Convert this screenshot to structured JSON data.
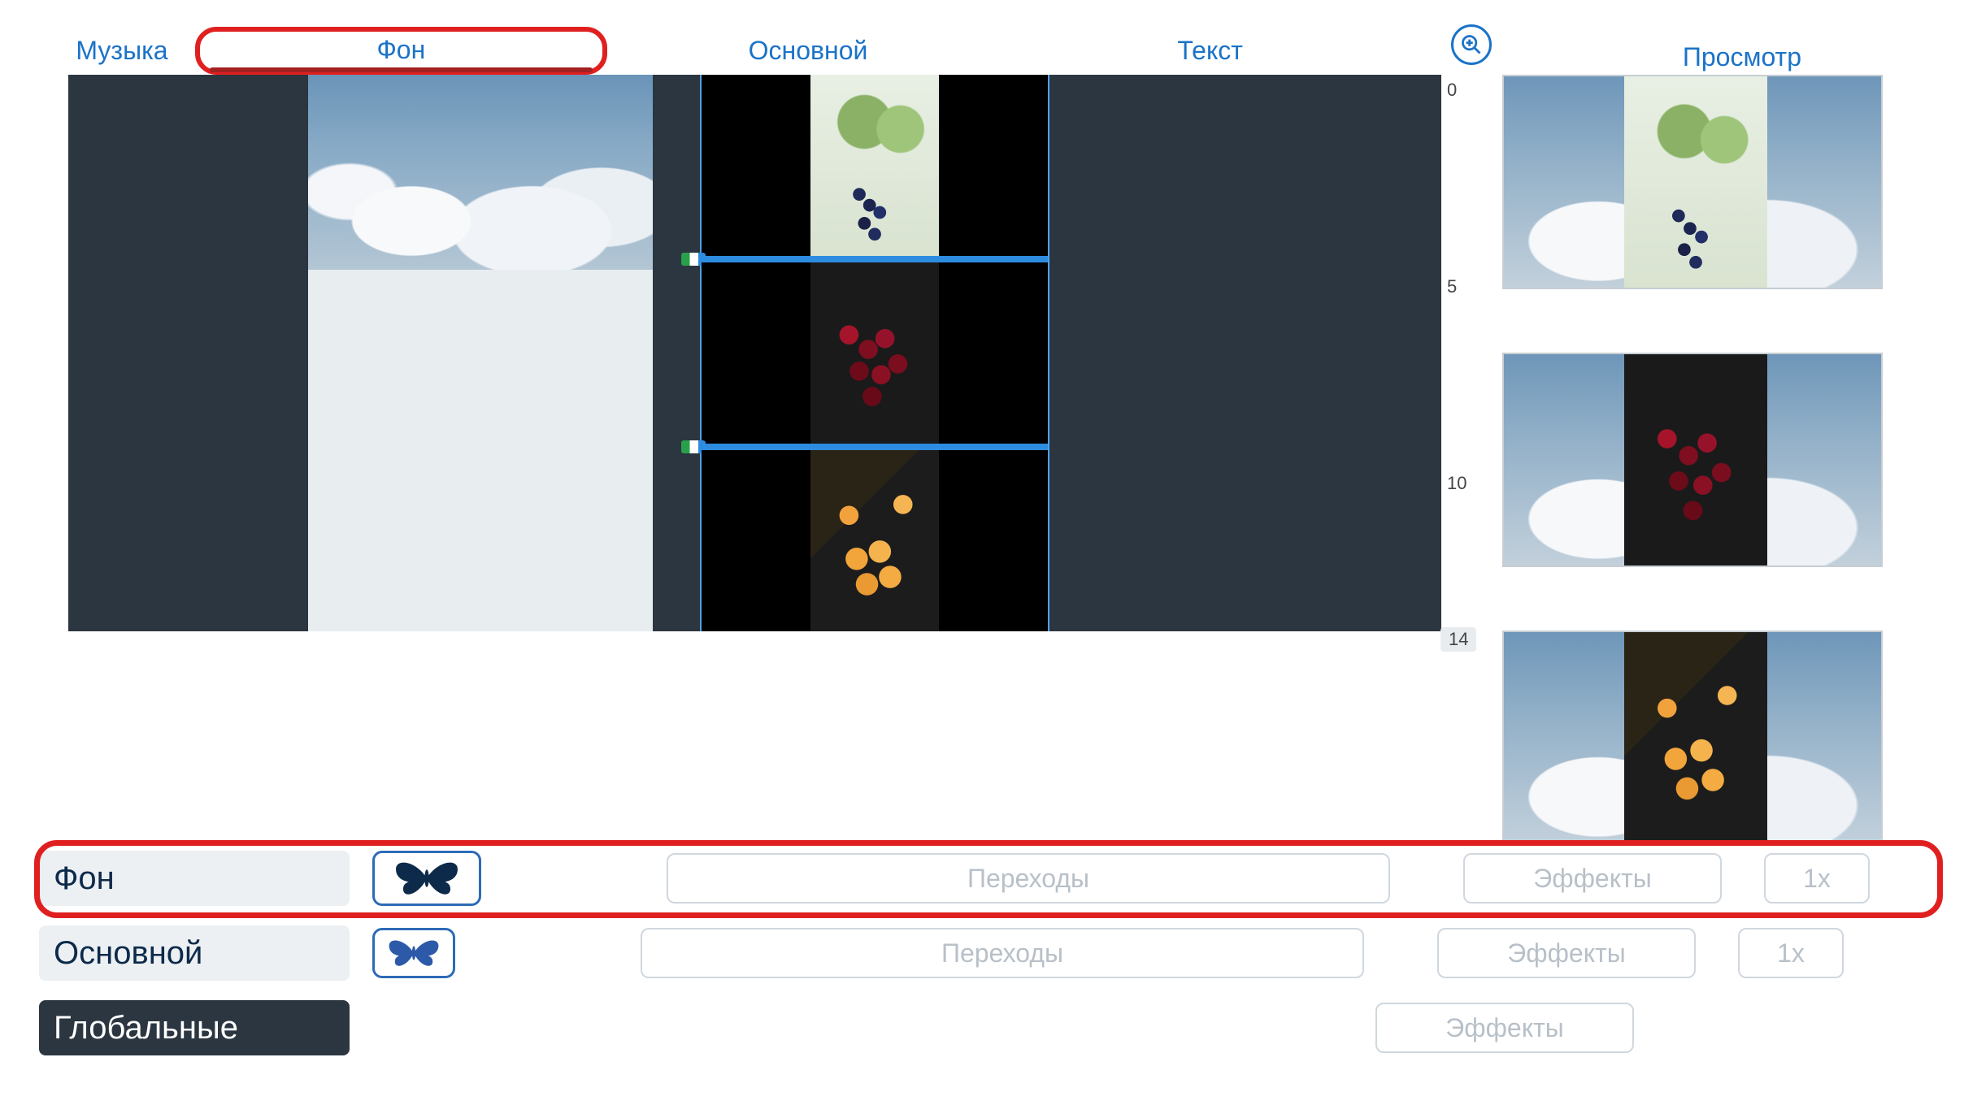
{
  "tabs": {
    "music": "Музыка",
    "background": "Фон",
    "main": "Основной",
    "text": "Текст",
    "preview": "Просмотр"
  },
  "ruler": {
    "t0": "0",
    "t5": "5",
    "t10": "10",
    "total": "14"
  },
  "layers": {
    "bg": {
      "name": "Фон",
      "transitions": "Переходы",
      "effects": "Эффекты",
      "multiplier": "1x"
    },
    "main": {
      "name": "Основной",
      "transitions": "Переходы",
      "effects": "Эффекты",
      "multiplier": "1x"
    },
    "global": {
      "name": "Глобальные",
      "effects": "Эффекты"
    }
  },
  "icons": {
    "zoom": "zoom-in-icon",
    "butterfly": "butterfly-icon"
  }
}
